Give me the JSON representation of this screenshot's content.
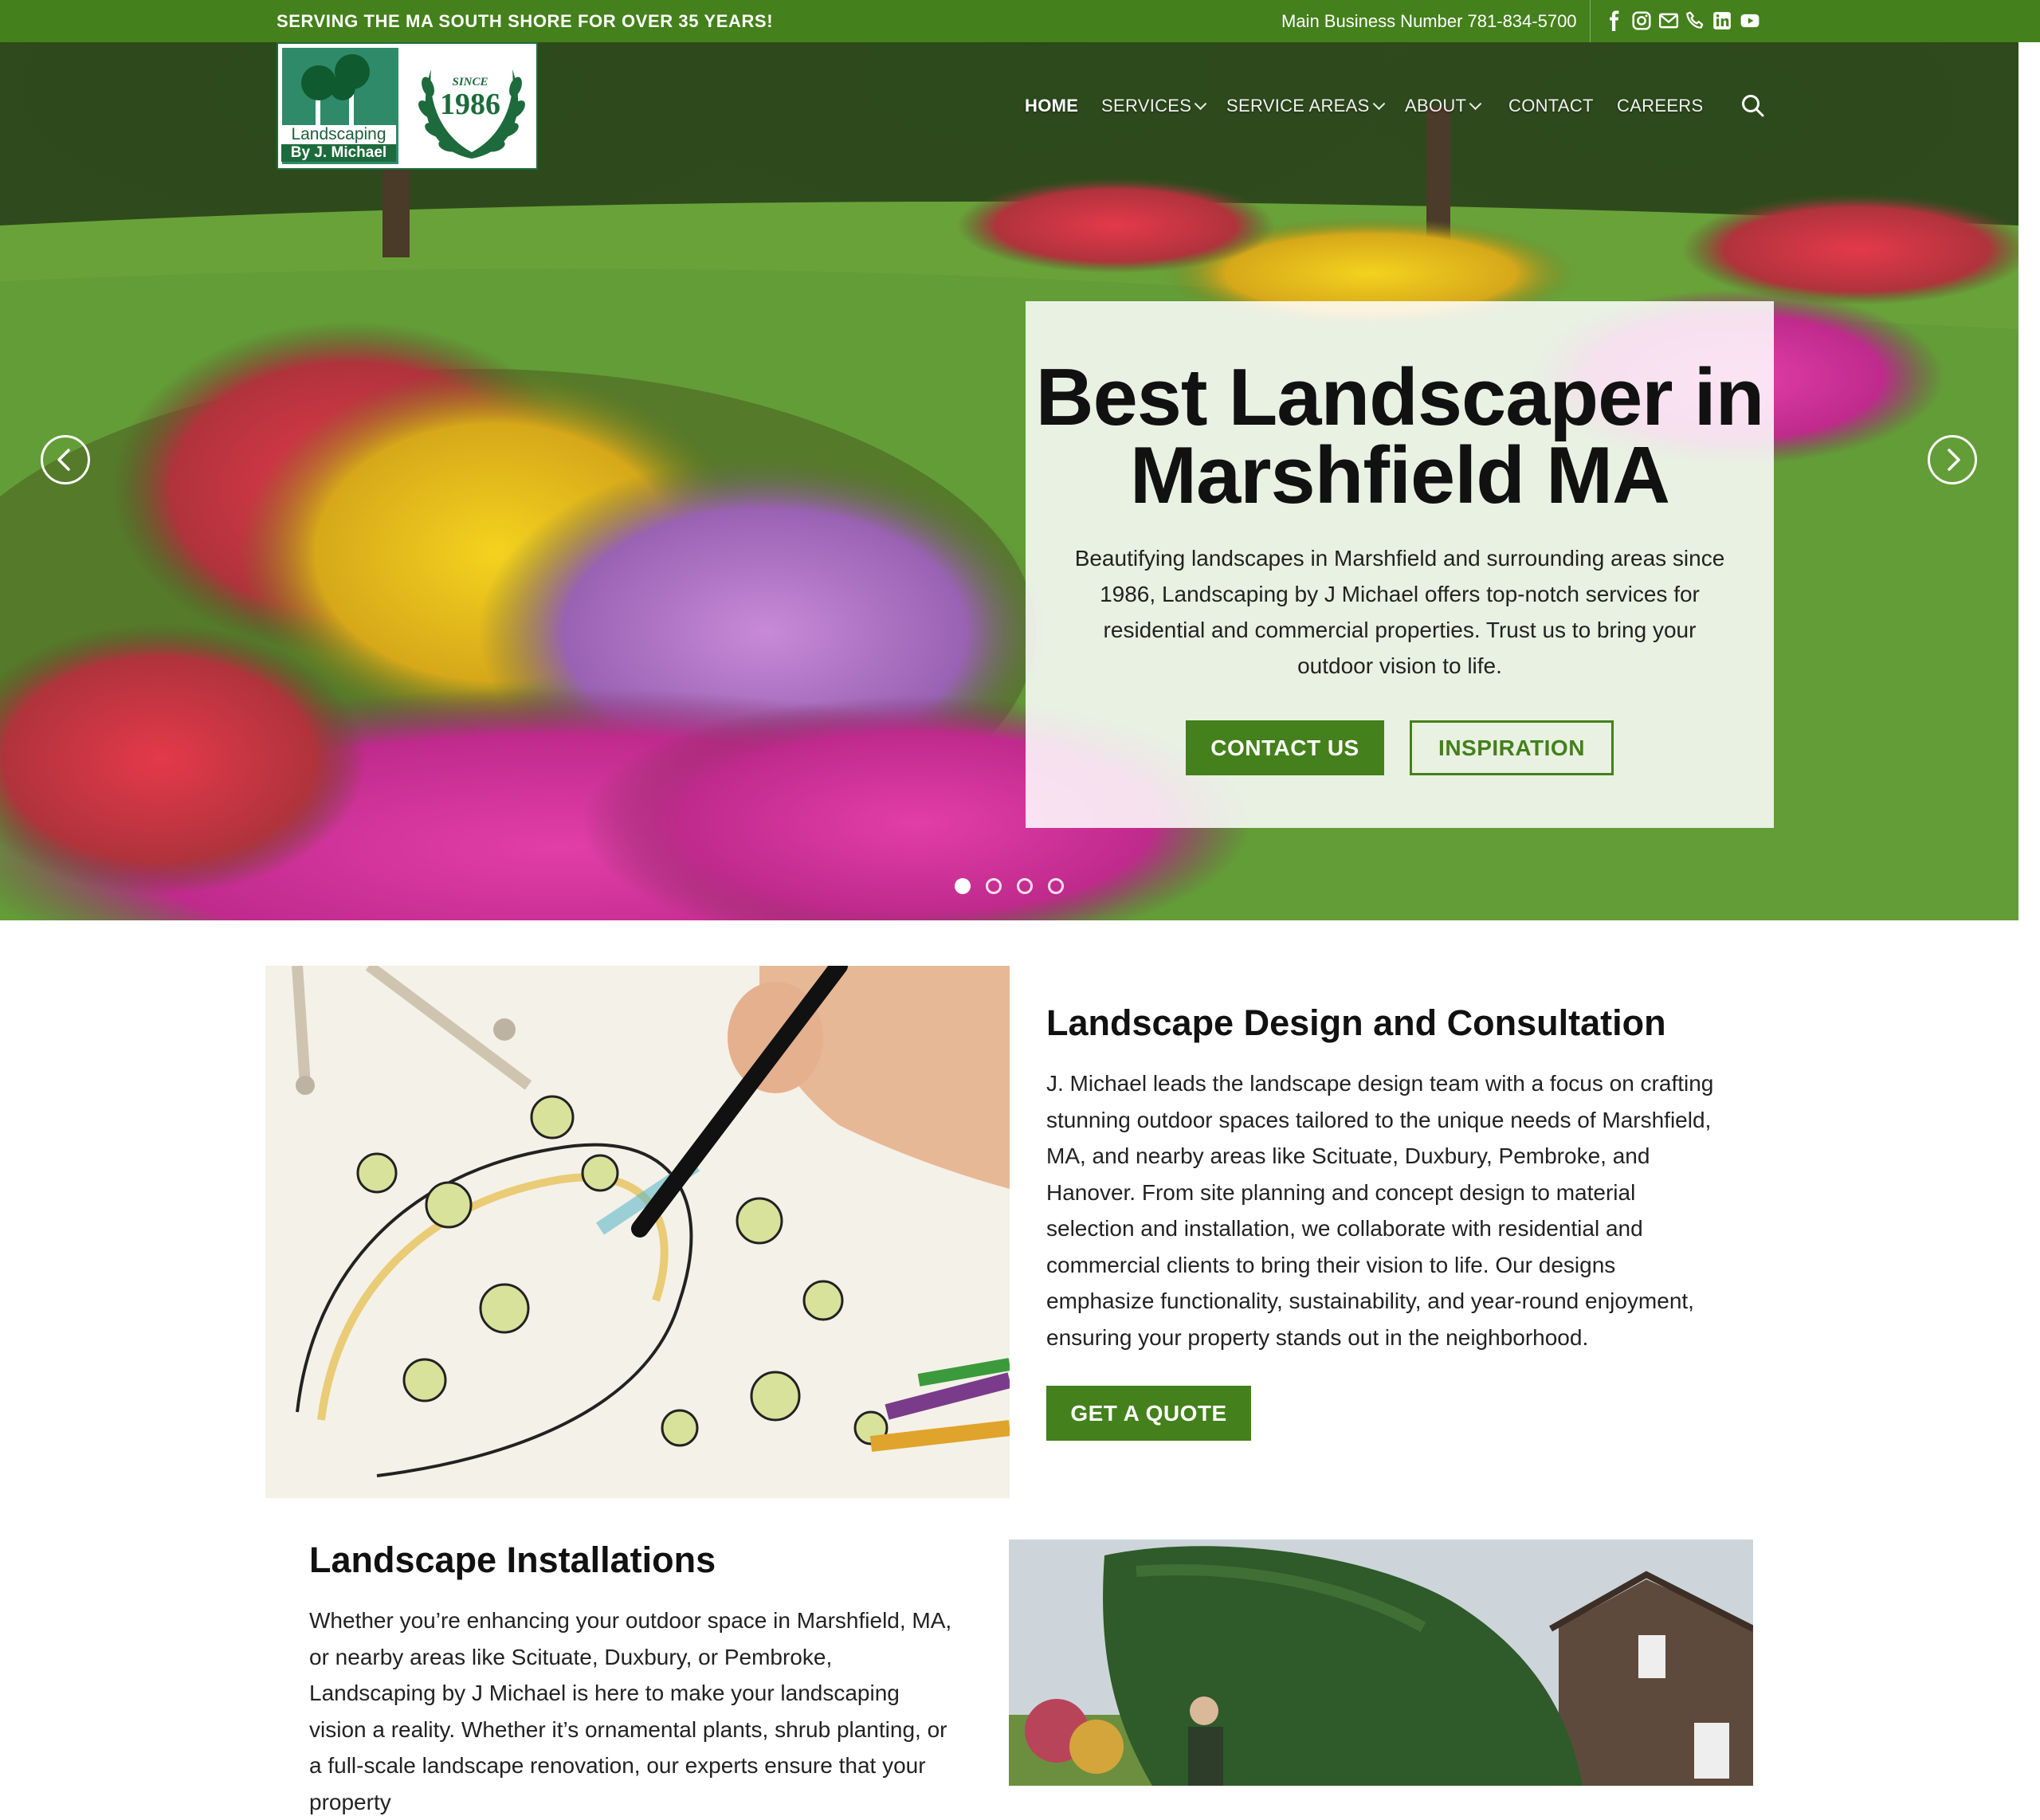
{
  "topbar": {
    "tagline": "SERVING THE MA SOUTH SHORE FOR OVER 35 YEARS!",
    "phone": "Main Business Number 781-834-5700",
    "social_icons": [
      "facebook-icon",
      "instagram-icon",
      "email-icon",
      "phone-icon",
      "linkedin-icon",
      "youtube-icon"
    ],
    "background_color": "#44801b"
  },
  "logo": {
    "line1": "Landscaping",
    "line2": "By J. Michael",
    "since_label": "SINCE",
    "since_year": "1986"
  },
  "nav": {
    "items": [
      {
        "label": "HOME",
        "active": true,
        "dropdown": false
      },
      {
        "label": "SERVICES",
        "active": false,
        "dropdown": true
      },
      {
        "label": "SERVICE AREAS",
        "active": false,
        "dropdown": true
      },
      {
        "label": "ABOUT",
        "active": false,
        "dropdown": true
      },
      {
        "label": "CONTACT",
        "active": false,
        "dropdown": false
      },
      {
        "label": "CAREERS",
        "active": false,
        "dropdown": false
      }
    ],
    "search_icon": "search-icon"
  },
  "hero": {
    "title": "Best Landscaper in Marshfield MA",
    "text": "Beautifying landscapes in Marshfield and surrounding areas since 1986, Landscaping by J Michael offers top-notch services for residential and commercial properties. Trust us to bring your outdoor vision to life.",
    "btn_primary": "CONTACT US",
    "btn_secondary": "INSPIRATION",
    "slide_count": 4,
    "active_slide": 1
  },
  "sections": {
    "design": {
      "heading": "Landscape Design and Consultation",
      "text": "J. Michael leads the landscape design team with a focus on crafting stunning outdoor spaces tailored to the unique needs of Marshfield, MA, and nearby areas like Scituate, Duxbury, Pembroke, and Hanover. From site planning and concept design to material selection and installation, we collaborate with residential and commercial clients to bring their vision to life. Our designs emphasize functionality, sustainability, and year-round enjoyment, ensuring your property stands out in the neighborhood.",
      "button": "GET A QUOTE"
    },
    "installations": {
      "heading": "Landscape Installations",
      "text": "Whether you’re enhancing your outdoor space in Marshfield, MA, or nearby areas like Scituate, Duxbury, or Pembroke, Landscaping by J Michael is here to make your landscaping vision a reality. Whether it’s ornamental plants, shrub planting, or a full-scale landscape renovation, our experts ensure that your property"
    }
  },
  "colors": {
    "brand_green": "#44801b",
    "logo_green": "#1d6b3c"
  }
}
